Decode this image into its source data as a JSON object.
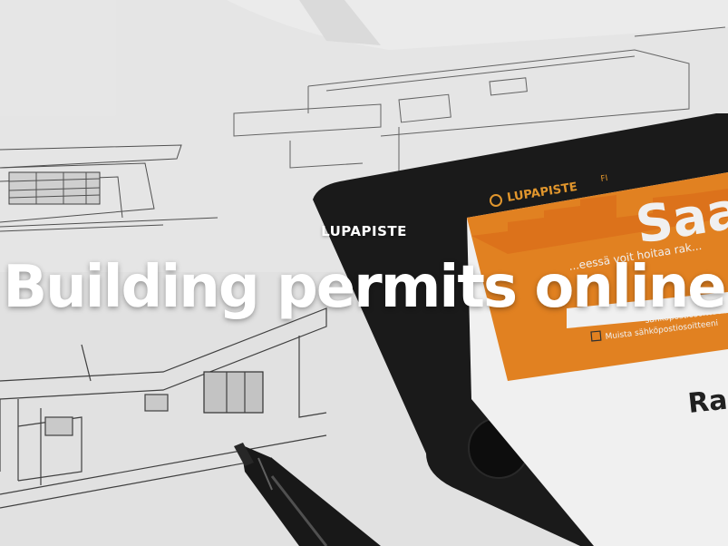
{
  "hero": {
    "eyebrow": "LUPAPISTE",
    "headline": "Building permits online"
  },
  "tablet_screen": {
    "logo_text": "LUPAPISTE",
    "lang": "FI",
    "banner_heading": "Saa",
    "banner_text": "...eessä voit hoitaa rak...",
    "email_placeholder": "sähköpostiosoitteen",
    "remember_label": "Muista sähköpostiosoitteeni",
    "section_heading": "Ra"
  },
  "colors": {
    "brand_orange": "#f08a24",
    "tablet_black": "#1c1c1c",
    "paper": "#f2f2f2"
  }
}
